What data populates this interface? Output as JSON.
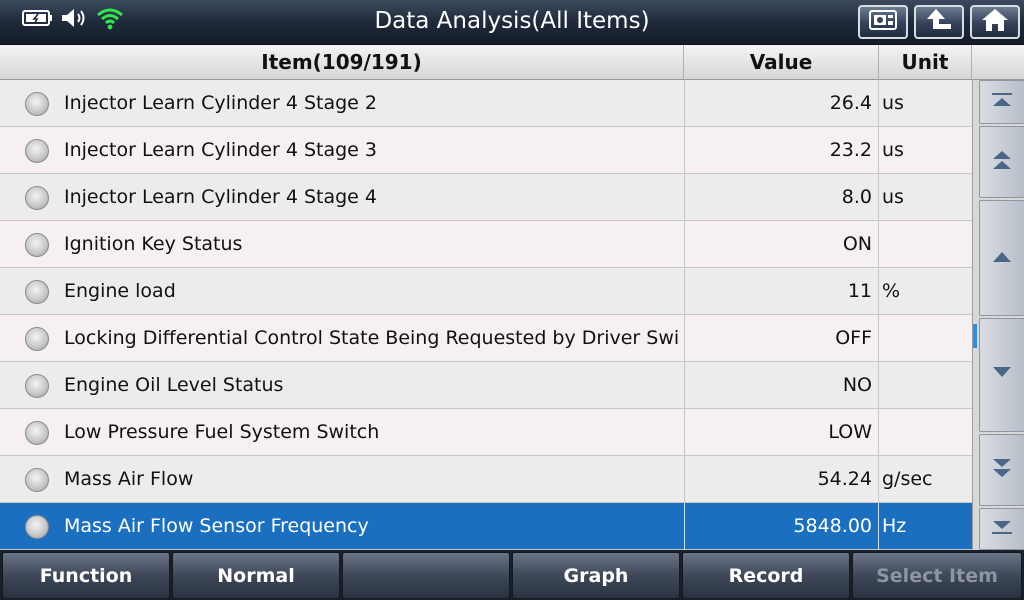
{
  "header": {
    "title": "Data Analysis(All Items)",
    "status_icons": [
      "battery-icon",
      "speaker-icon",
      "wifi-icon"
    ],
    "buttons": [
      "screenshot-icon",
      "back-icon",
      "home-icon"
    ]
  },
  "table": {
    "columns": {
      "item": "Item(109/191)",
      "value": "Value",
      "unit": "Unit"
    },
    "rows": [
      {
        "name": "Injector Learn Cylinder 4 Stage 2",
        "value": "26.4",
        "unit": "us"
      },
      {
        "name": "Injector Learn Cylinder 4 Stage 3",
        "value": "23.2",
        "unit": "us"
      },
      {
        "name": "Injector Learn Cylinder 4 Stage 4",
        "value": "8.0",
        "unit": "us"
      },
      {
        "name": "Ignition Key Status",
        "value": "ON",
        "unit": ""
      },
      {
        "name": "Engine load",
        "value": "11",
        "unit": "%"
      },
      {
        "name": "Locking Differential Control State Being Requested by Driver Switch",
        "value": "OFF",
        "unit": ""
      },
      {
        "name": "Engine Oil Level Status",
        "value": "NO",
        "unit": ""
      },
      {
        "name": "Low Pressure Fuel System Switch",
        "value": "LOW",
        "unit": ""
      },
      {
        "name": "Mass Air Flow",
        "value": "54.24",
        "unit": "g/sec"
      },
      {
        "name": "Mass Air Flow Sensor Frequency",
        "value": "5848.00",
        "unit": "Hz"
      }
    ],
    "selected_index": 9
  },
  "scroll": {
    "buttons": [
      "scroll-top-icon",
      "page-up-icon",
      "line-up-icon",
      "line-down-icon",
      "page-down-icon",
      "scroll-bottom-icon"
    ]
  },
  "toolbar": {
    "function_label": "Function",
    "normal_label": "Normal",
    "empty_label": "",
    "graph_label": "Graph",
    "record_label": "Record",
    "select_item_label": "Select Item"
  },
  "colors": {
    "selected_row": "#1a6fc1",
    "title_bar": "#1f2a3b",
    "wifi": "#2ee84a"
  }
}
